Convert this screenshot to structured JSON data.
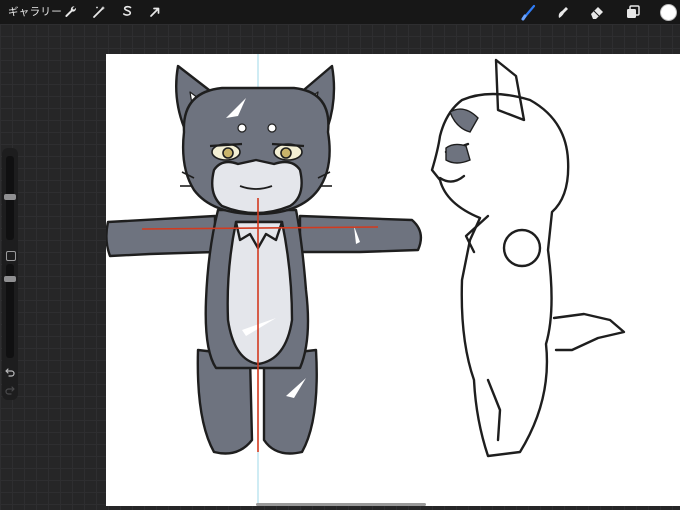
{
  "topbar": {
    "gallery_label": "ギャラリー",
    "left_tools": [
      {
        "name": "actions",
        "icon": "wrench-icon"
      },
      {
        "name": "adjustments",
        "icon": "magic-wand-icon"
      },
      {
        "name": "selection",
        "icon": "selection-s-icon"
      },
      {
        "name": "transform",
        "icon": "arrow-cursor-icon"
      }
    ],
    "right_tools": [
      {
        "name": "brush",
        "icon": "brush-icon",
        "active": true
      },
      {
        "name": "smudge",
        "icon": "smudge-icon",
        "active": false
      },
      {
        "name": "eraser",
        "icon": "eraser-icon",
        "active": false
      },
      {
        "name": "layers",
        "icon": "layers-icon",
        "active": false
      }
    ],
    "current_color": "#ffffff",
    "accent_color": "#2f7cf6"
  },
  "sidebar": {
    "brush_size_level": 0.32,
    "opacity_level": 0.05,
    "undo_icon": "undo-icon",
    "redo_icon": "redo-icon",
    "modify_icon": "square-modify-icon"
  },
  "artwork": {
    "front_fill": "#6e737f",
    "belly_fill": "#e4e6eb",
    "guide_color": "#d23a1f",
    "symmetry_guide_color": "#9fd8e8"
  }
}
